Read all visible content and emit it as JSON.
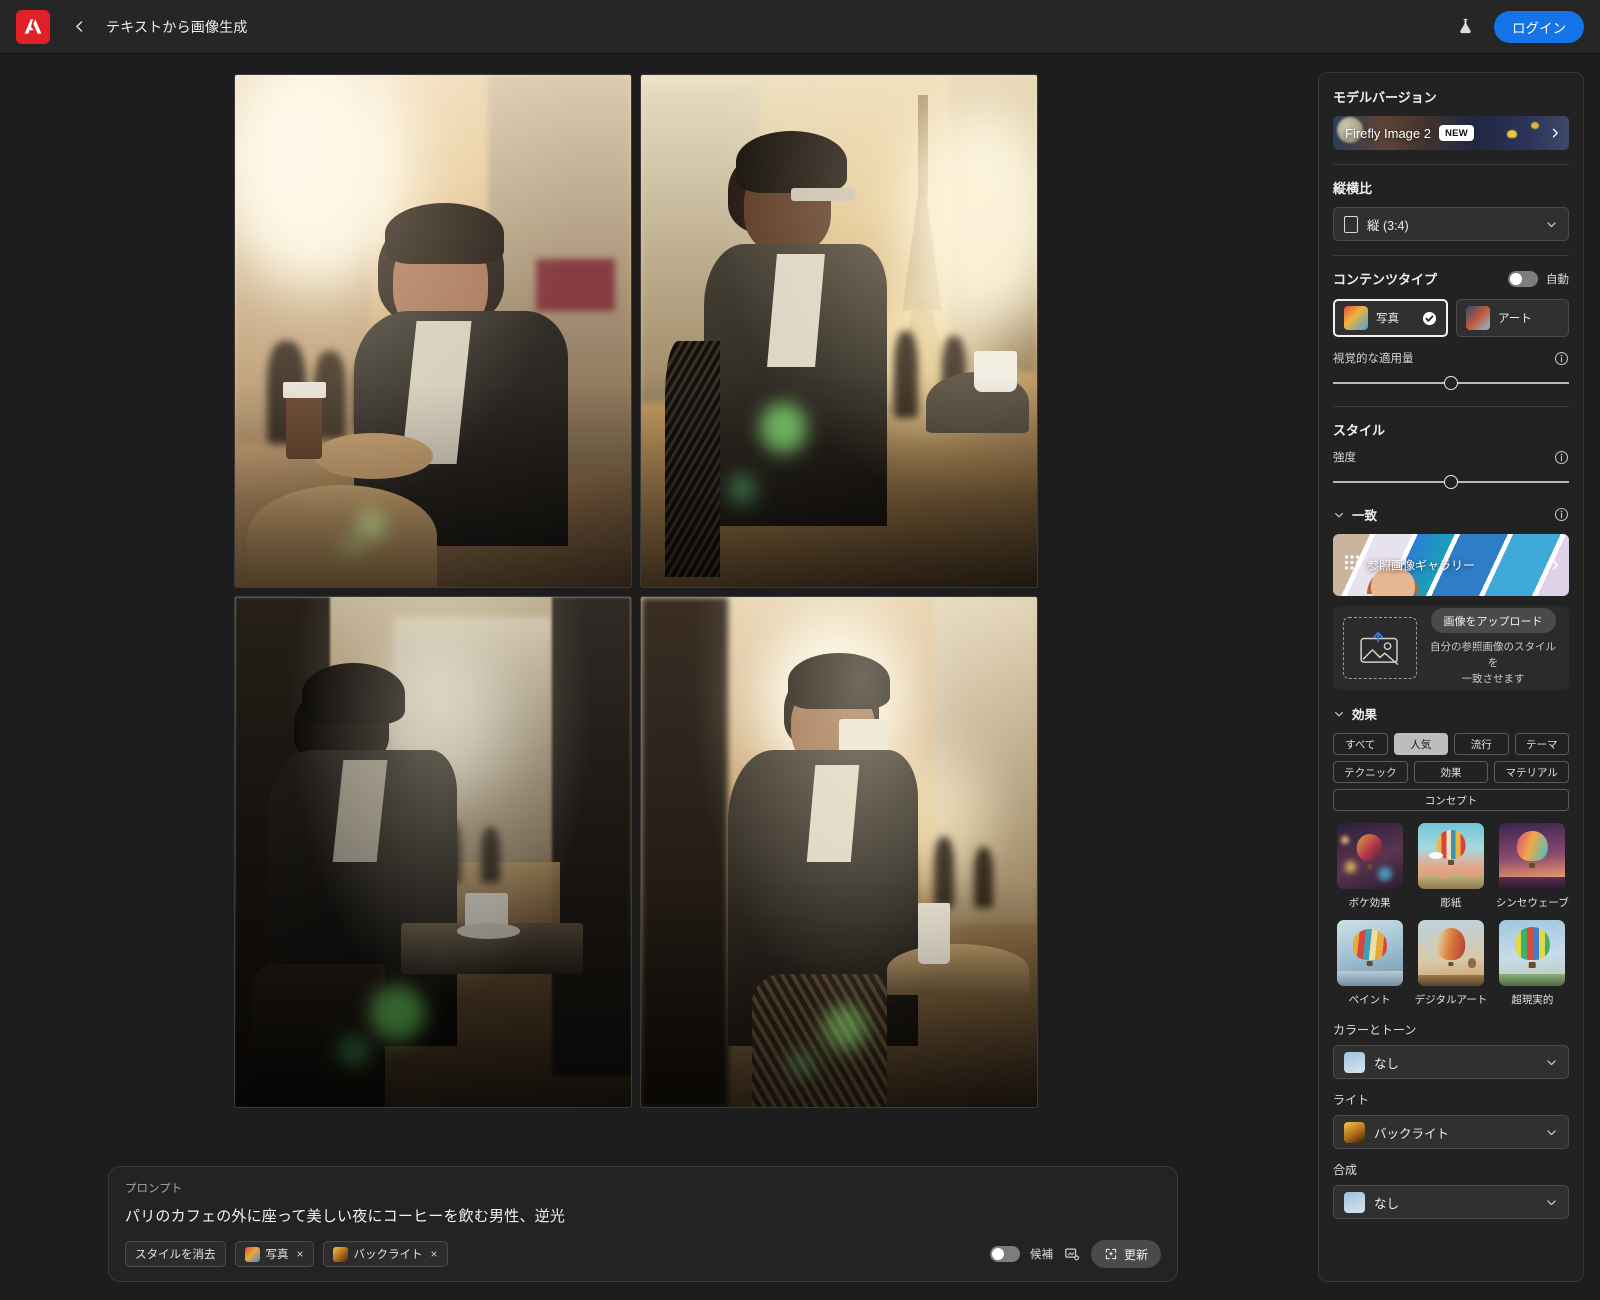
{
  "header": {
    "app_logo": "adobe-logo",
    "back_icon": "chevron-left-icon",
    "title": "テキストから画像生成",
    "lab_icon": "flask-icon",
    "login_label": "ログイン"
  },
  "canvas": {
    "images": [
      {
        "alt": "パリの通りでコーヒーを持つ男性"
      },
      {
        "alt": "エッフェル塔を背にカフェに座る男性"
      },
      {
        "alt": "夕暮れのテラスに座る男性のシルエット"
      },
      {
        "alt": "コーヒーを飲む男性の横顔"
      }
    ]
  },
  "prompt": {
    "label": "プロンプト",
    "text": "パリのカフェの外に座って美しい夜にコーヒーを飲む男性、逆光",
    "clear_styles_label": "スタイルを消去",
    "chips": [
      {
        "label": "写真",
        "remove": "×"
      },
      {
        "label": "バックライト",
        "remove": "×"
      }
    ],
    "candidates_label": "候補",
    "candidates_on": false,
    "compare_icon": "compare-icon",
    "refresh_label": "更新",
    "refresh_icon": "refresh-sparkle-icon"
  },
  "sidebar": {
    "model_version": {
      "title": "モデルバージョン",
      "value": "Firefly Image 2",
      "badge": "NEW",
      "chevron": "chevron-right-icon"
    },
    "aspect_ratio": {
      "title": "縦横比",
      "value": "縦 (3:4)",
      "icon": "portrait-frame-icon",
      "chevron": "chevron-down-icon"
    },
    "content_type": {
      "title": "コンテンツタイプ",
      "auto_label": "自動",
      "auto_on": false,
      "options": [
        {
          "label": "写真",
          "selected": true
        },
        {
          "label": "アート",
          "selected": false
        }
      ]
    },
    "visual_intensity": {
      "label": "視覚的な適用量",
      "info_icon": "info-icon",
      "value_pct": 50
    },
    "style": {
      "title": "スタイル",
      "strength_label": "強度",
      "strength_info_icon": "info-icon",
      "strength_pct": 50
    },
    "match": {
      "title": "一致",
      "caret": "chevron-down-icon",
      "info_icon": "info-icon",
      "gallery_label": "参照画像ギャラリー",
      "gallery_icon": "grid-icon",
      "gallery_chevron": "chevron-right-icon",
      "upload_button": "画像をアップロード",
      "upload_icon": "upload-image-icon",
      "upload_description_line1": "自分の参照画像のスタイルを",
      "upload_description_line2": "一致させます"
    },
    "effects": {
      "title": "効果",
      "caret": "chevron-down-icon",
      "filters_row1": [
        {
          "label": "すべて",
          "active": false
        },
        {
          "label": "人気",
          "active": true
        },
        {
          "label": "流行",
          "active": false
        },
        {
          "label": "テーマ",
          "active": false
        }
      ],
      "filters_row2": [
        {
          "label": "テクニック",
          "active": false
        },
        {
          "label": "効果",
          "active": false
        },
        {
          "label": "マテリアル",
          "active": false
        }
      ],
      "filters_row3": [
        {
          "label": "コンセプト",
          "active": false
        }
      ],
      "items": [
        {
          "label": "ボケ効果"
        },
        {
          "label": "彫紙"
        },
        {
          "label": "シンセウェーブ"
        },
        {
          "label": "ペイント"
        },
        {
          "label": "デジタルアート"
        },
        {
          "label": "超現実的"
        }
      ]
    },
    "color_tone": {
      "title": "カラーとトーン",
      "value": "なし",
      "chevron": "chevron-down-icon"
    },
    "light": {
      "title": "ライト",
      "value": "バックライト",
      "chevron": "chevron-down-icon"
    },
    "composition": {
      "title": "合成",
      "value": "なし",
      "chevron": "chevron-down-icon"
    }
  },
  "colors": {
    "accent_blue": "#1473e6",
    "adobe_red": "#e01f26",
    "panel_bg": "#222222",
    "header_bg": "#262626",
    "canvas_bg": "#1d1d1d",
    "chip_active": "#bdbdbd"
  }
}
